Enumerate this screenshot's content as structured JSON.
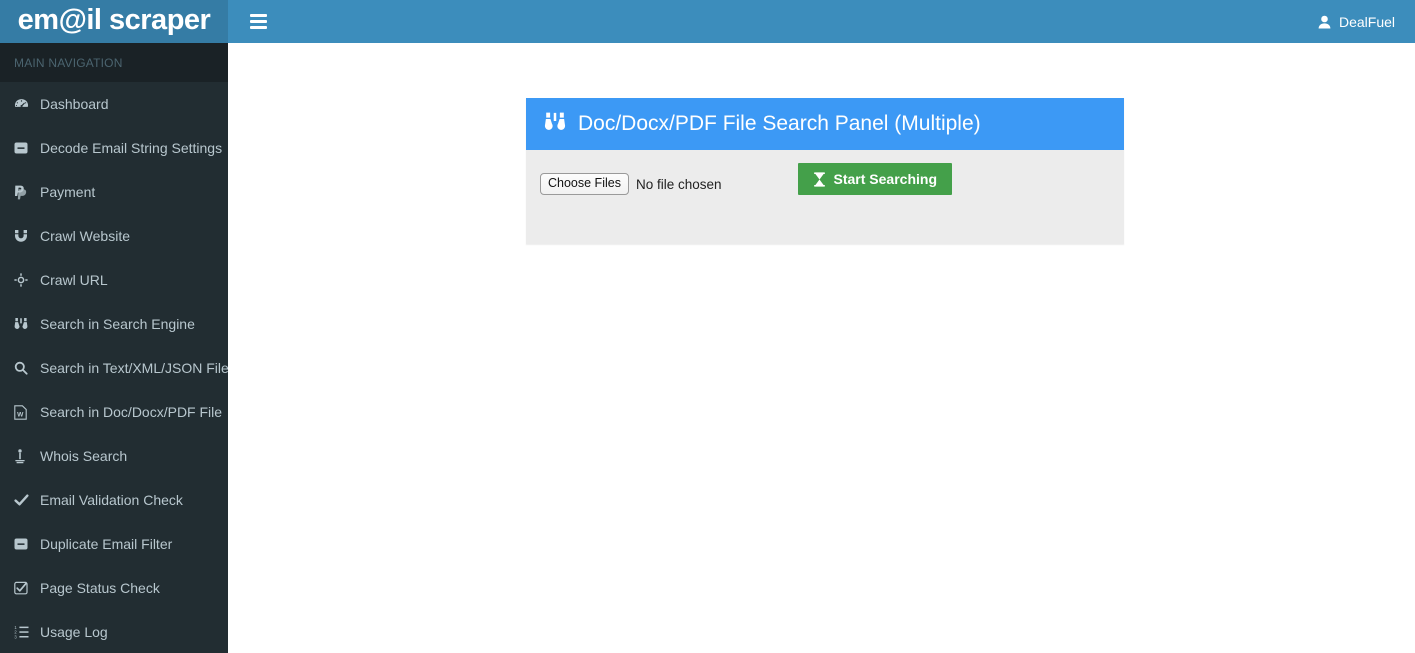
{
  "brand": {
    "logo_text": "em@il scraper",
    "logo_bg": "#357ca5"
  },
  "navbar": {
    "toggle_icon": "hamburger-icon",
    "user_icon": "user-icon",
    "user_name": "DealFuel",
    "bg": "#3c8dbc"
  },
  "sidebar": {
    "header": "MAIN NAVIGATION",
    "bg": "#222d32",
    "items": [
      {
        "label": "Dashboard",
        "icon": "tachometer-icon"
      },
      {
        "label": "Decode Email String Settings",
        "icon": "minus-square-icon"
      },
      {
        "label": "Payment",
        "icon": "paypal-icon"
      },
      {
        "label": "Crawl Website",
        "icon": "magnet-icon"
      },
      {
        "label": "Crawl URL",
        "icon": "crosshairs-icon"
      },
      {
        "label": "Search in Search Engine",
        "icon": "binoculars-icon"
      },
      {
        "label": "Search in Text/XML/JSON File",
        "icon": "search-icon"
      },
      {
        "label": "Search in Doc/Docx/PDF File",
        "icon": "file-word-icon"
      },
      {
        "label": "Whois Search",
        "icon": "whois-icon"
      },
      {
        "label": "Email Validation Check",
        "icon": "check-icon"
      },
      {
        "label": "Duplicate Email Filter",
        "icon": "minus-square-icon"
      },
      {
        "label": "Page Status Check",
        "icon": "check-square-icon"
      },
      {
        "label": "Usage Log",
        "icon": "list-ol-icon"
      }
    ]
  },
  "panel": {
    "title": "Doc/Docx/PDF File Search Panel (Multiple)",
    "title_icon": "binoculars-icon",
    "header_bg": "#3c99f5",
    "body_bg": "#ececec",
    "file_input": {
      "button_label": "Choose Files",
      "status_text": "No file chosen"
    },
    "submit": {
      "label": "Start Searching",
      "icon": "hourglass-icon",
      "bg": "#44a04a"
    }
  }
}
